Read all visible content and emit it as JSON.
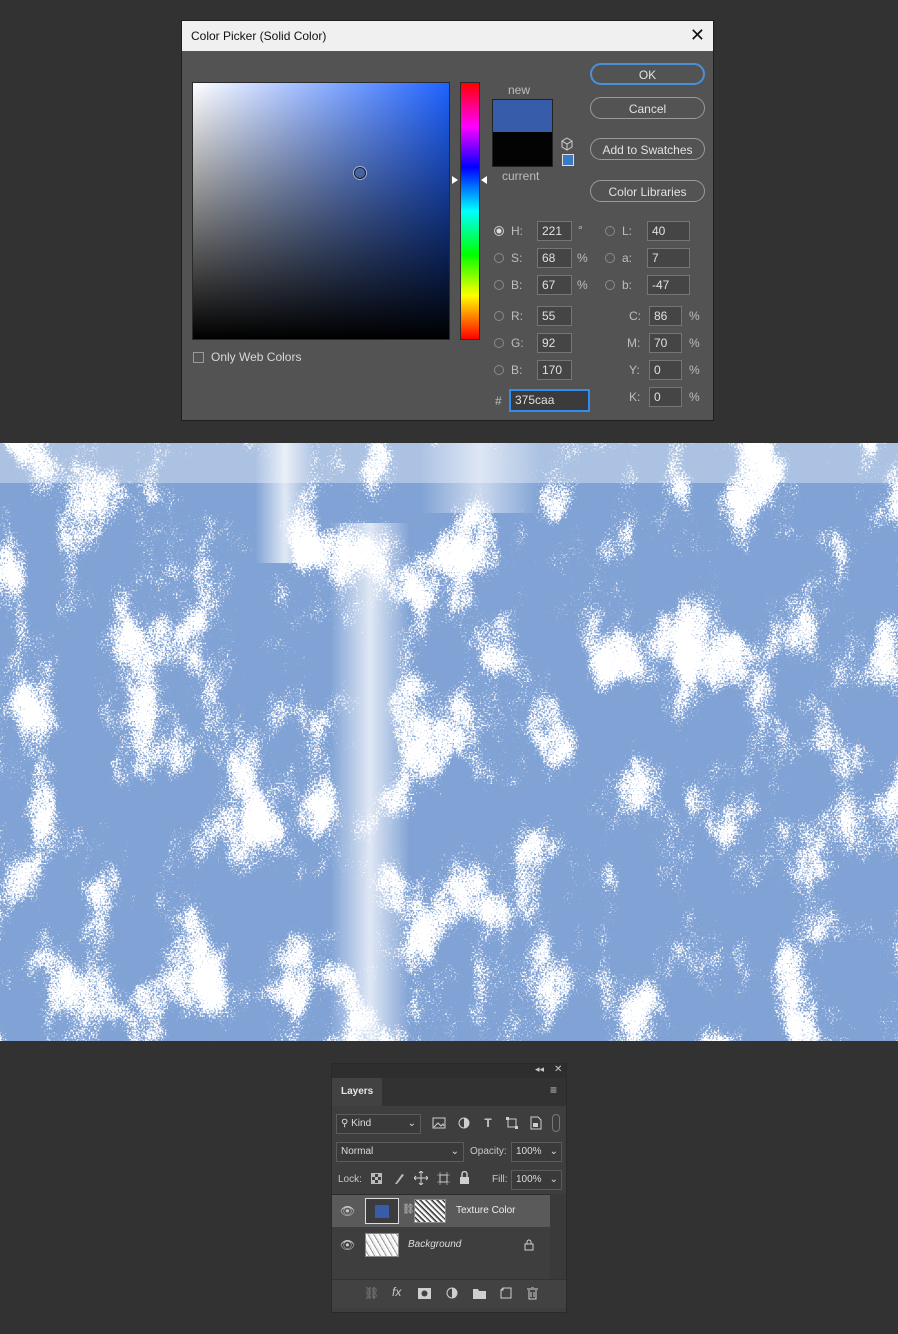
{
  "dialog": {
    "title": "Color Picker (Solid Color)",
    "close_glyph": "✕",
    "new_label": "new",
    "current_label": "current",
    "new_color": "#375caa",
    "current_color": "#030303",
    "buttons": {
      "ok": "OK",
      "cancel": "Cancel",
      "add_swatches": "Add to Swatches",
      "libraries": "Color Libraries"
    },
    "only_web_colors": "Only Web Colors",
    "fields": {
      "h": {
        "label": "H:",
        "value": "221",
        "unit": "°"
      },
      "s": {
        "label": "S:",
        "value": "68",
        "unit": "%"
      },
      "bri": {
        "label": "B:",
        "value": "67",
        "unit": "%"
      },
      "r": {
        "label": "R:",
        "value": "55"
      },
      "g": {
        "label": "G:",
        "value": "92"
      },
      "b": {
        "label": "B:",
        "value": "170"
      },
      "l": {
        "label": "L:",
        "value": "40"
      },
      "a": {
        "label": "a:",
        "value": "7"
      },
      "lab_b": {
        "label": "b:",
        "value": "-47"
      },
      "c": {
        "label": "C:",
        "value": "86",
        "unit": "%"
      },
      "m": {
        "label": "M:",
        "value": "70",
        "unit": "%"
      },
      "y": {
        "label": "Y:",
        "value": "0",
        "unit": "%"
      },
      "k": {
        "label": "K:",
        "value": "0",
        "unit": "%"
      }
    },
    "hex_label": "#",
    "hex_value": "375caa"
  },
  "canvas": {
    "texture_color": "#375caa"
  },
  "layers_panel": {
    "tab_label": "Layers",
    "filter_kind": "Kind",
    "blend_mode": "Normal",
    "opacity_label": "Opacity:",
    "opacity_value": "100%",
    "lock_label": "Lock:",
    "fill_label": "Fill:",
    "fill_value": "100%",
    "layers": [
      {
        "name": "Texture Color",
        "selected": true
      },
      {
        "name": "Background",
        "locked": true
      }
    ]
  }
}
